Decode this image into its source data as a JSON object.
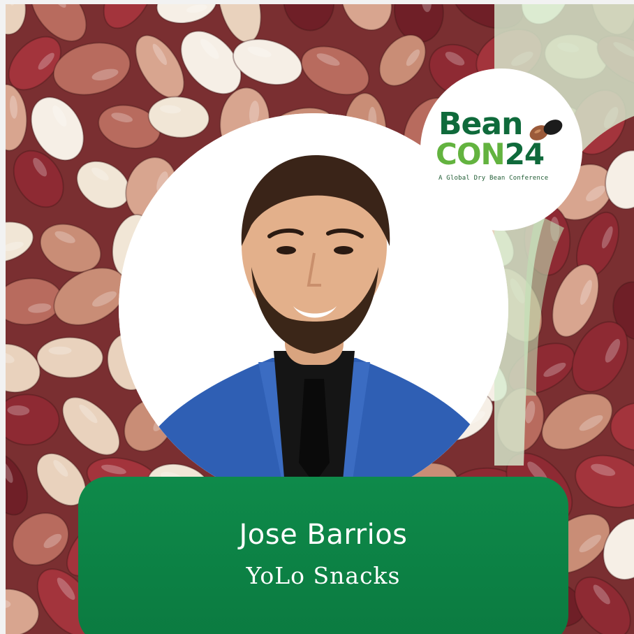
{
  "logo": {
    "word": "Bean",
    "con": "CON",
    "year": "24",
    "tagline": "A Global Dry Bean Conference",
    "icon": "bean-pair-icon"
  },
  "speaker": {
    "name": "Jose Barrios",
    "organization": "YoLo Snacks"
  },
  "colors": {
    "brand_dark_green": "#0f6a3b",
    "brand_light_green": "#63b33f",
    "panel_green": "#0e8a4a",
    "accent_wave": "#cfe8c8"
  }
}
